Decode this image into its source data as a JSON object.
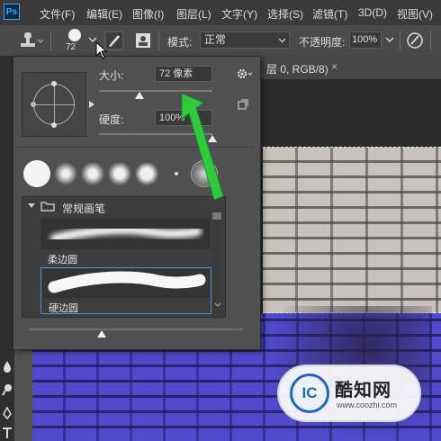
{
  "menubar": {
    "logo": "Ps",
    "items": [
      "文件(F)",
      "编辑(E)",
      "图像(I)",
      "图层(L)",
      "文字(Y)",
      "选择(S)",
      "滤镜(T)",
      "3D(D)",
      "视图(V)"
    ]
  },
  "options": {
    "brush_size": "72",
    "mode_label": "模式:",
    "mode_value": "正常",
    "opacity_label": "不透明度:",
    "opacity_value": "100%"
  },
  "document": {
    "tab_label": "层 0, RGB/8)",
    "close": "×"
  },
  "brush_panel": {
    "size_label": "大小:",
    "size_value": "72 像素",
    "size_slider_fraction": 0.36,
    "hardness_label": "硬度:",
    "hardness_value": "100%",
    "hardness_slider_fraction": 1.0,
    "group_name": "常规画笔",
    "brushes": [
      {
        "name": "柔边圆"
      },
      {
        "name": "硬边圆"
      }
    ]
  },
  "watermark": {
    "logo": "IC",
    "title": "酷知网",
    "url": "www.coozhi.com"
  },
  "colors": {
    "accent_arrow": "#2ecc3c",
    "selection": "#5aa0e6",
    "blue_layer": "#4a46c4"
  }
}
